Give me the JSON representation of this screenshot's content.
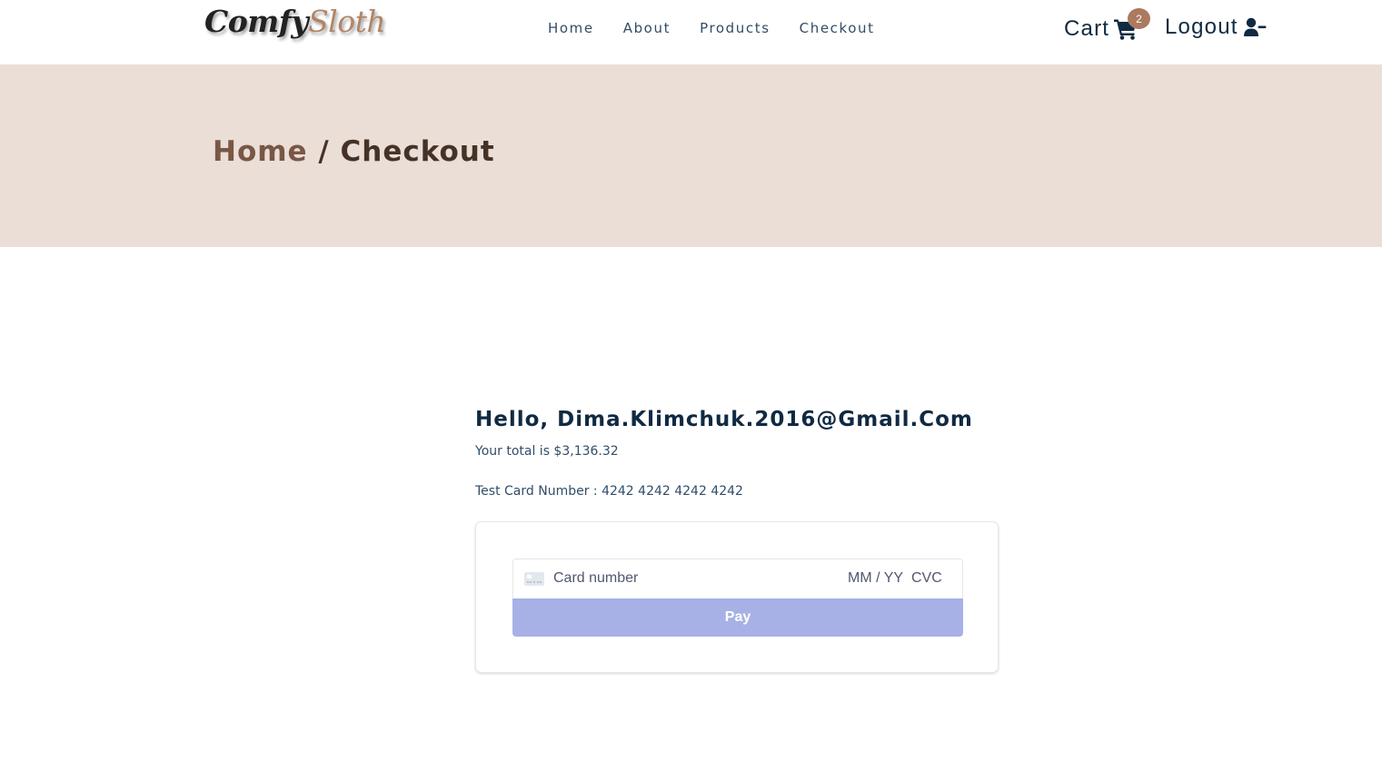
{
  "navbar": {
    "logo": {
      "part1": "Comfy",
      "part2": "Sloth"
    },
    "links": [
      {
        "label": "Home"
      },
      {
        "label": "About"
      },
      {
        "label": "Products"
      },
      {
        "label": "Checkout"
      }
    ],
    "cart": {
      "label": "Cart",
      "count": "2",
      "icon": "shopping-cart-icon"
    },
    "logout": {
      "label": "Logout",
      "icon": "user-minus-icon"
    }
  },
  "hero": {
    "breadcrumb_home": "Home",
    "breadcrumb_separator": " / ",
    "breadcrumb_current": "Checkout"
  },
  "checkout": {
    "greeting": "Hello, Dima.Klimchuk.2016@Gmail.Com",
    "total": "Your total is $3,136.32",
    "test_card": "Test Card Number : 4242 4242 4242 4242",
    "card_number_placeholder": "Card number",
    "expiry_placeholder": "MM / YY",
    "cvc_placeholder": "CVC",
    "pay_label": "Pay"
  },
  "colors": {
    "brand": "#ab7a5f",
    "hero_bg": "#eaded7",
    "pay_button": "#a7b1e6",
    "text_dark": "#102a42"
  }
}
